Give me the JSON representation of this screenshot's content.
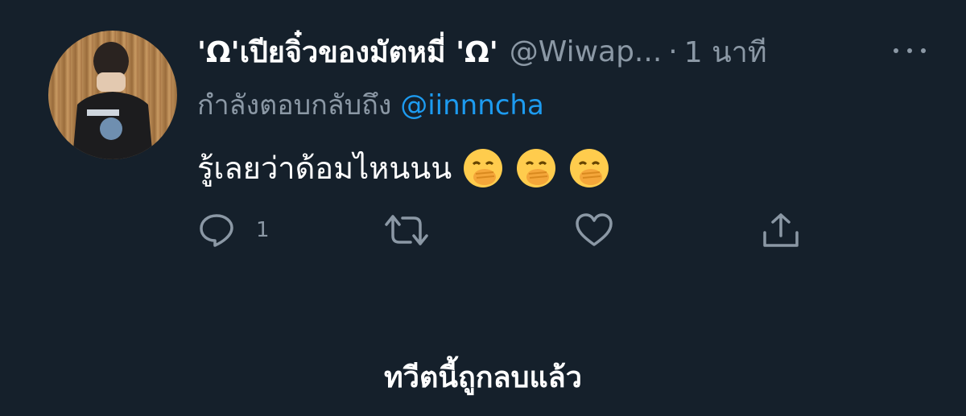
{
  "tweet": {
    "display_name": "'Ω'เปียจิ๋วของมัตหมี่ 'Ω'",
    "handle": "@Wiwap...",
    "separator": "·",
    "timestamp": "1 นาที",
    "replying_to_label": "กำลังตอบกลับถึง",
    "replying_to_mention": "@iinnncha",
    "text": "รู้เลยว่าด้อมไหนนน",
    "emojis": [
      "face-with-hand-over-mouth",
      "face-with-hand-over-mouth",
      "face-with-hand-over-mouth"
    ],
    "actions": {
      "reply_icon": "reply-icon",
      "reply_count": "1",
      "retweet_icon": "retweet-icon",
      "like_icon": "heart-icon",
      "share_icon": "share-icon"
    }
  },
  "deleted_notice": "ทวีตนี้ถูกลบแล้ว",
  "colors": {
    "background": "#15202b",
    "secondary_text": "#8b98a5",
    "mention": "#1d9bf0",
    "primary_text": "#ffffff"
  }
}
